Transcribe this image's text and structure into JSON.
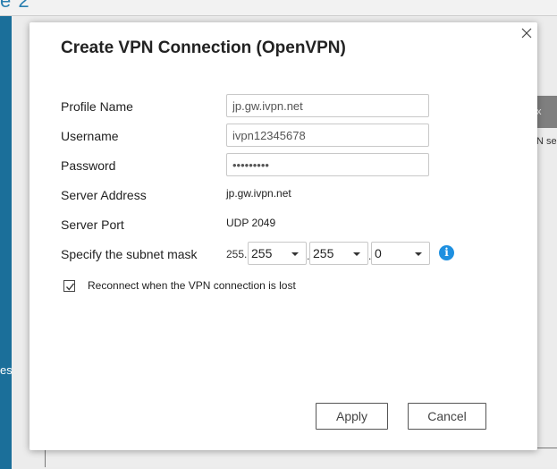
{
  "background": {
    "title_fragment": "e 2",
    "sidebar_fragment": "es",
    "right_chip_text": "x",
    "right_text_fragment": "N se"
  },
  "dialog": {
    "title": "Create VPN Connection (OpenVPN)",
    "fields": {
      "profile_name": {
        "label": "Profile Name",
        "value": "jp.gw.ivpn.net"
      },
      "username": {
        "label": "Username",
        "value": "ivpn12345678"
      },
      "password": {
        "label": "Password",
        "value": "•••••••••"
      },
      "server_address": {
        "label": "Server Address",
        "value": "jp.gw.ivpn.net"
      },
      "server_port": {
        "label": "Server Port",
        "value": "UDP 2049"
      },
      "subnet_mask": {
        "label": "Specify the subnet mask",
        "fixed_octet": "255.",
        "octet2": "255",
        "octet3": "255",
        "octet4": "0",
        "dot": "."
      }
    },
    "reconnect": {
      "label": "Reconnect when the VPN connection is lost",
      "checked": true
    },
    "buttons": {
      "apply": "Apply",
      "cancel": "Cancel"
    }
  },
  "colors": {
    "sidebar": "#1b6f9a",
    "info_icon": "#1e90e0",
    "title_accent": "#2a7fb0"
  }
}
